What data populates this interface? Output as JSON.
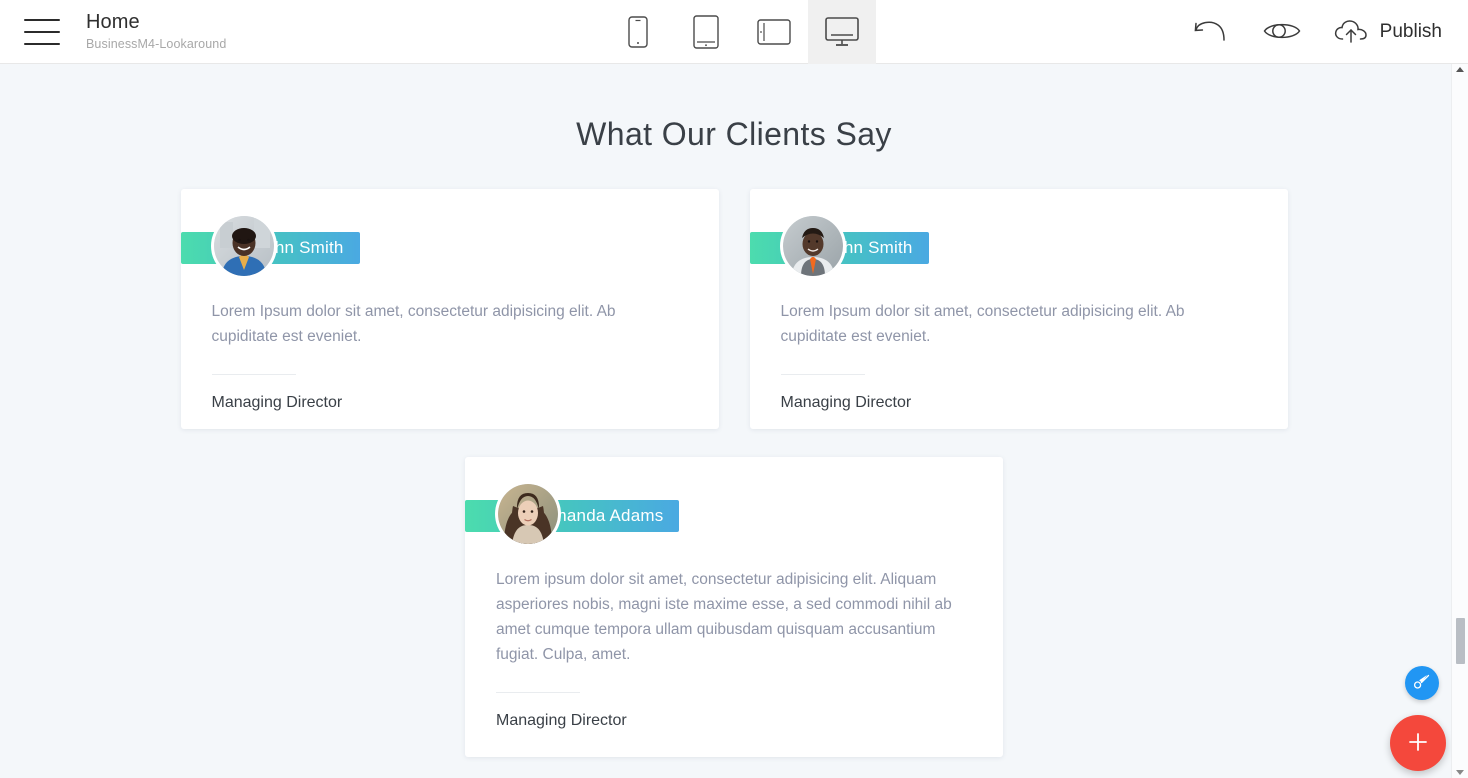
{
  "toolbar": {
    "menu_icon": "hamburger-icon",
    "page_title": "Home",
    "page_subtitle": "BusinessM4-Lookaround",
    "devices": [
      {
        "id": "mobile",
        "icon": "mobile-icon",
        "active": false
      },
      {
        "id": "tablet",
        "icon": "tablet-portrait-icon",
        "active": false
      },
      {
        "id": "landscape",
        "icon": "tablet-landscape-icon",
        "active": false
      },
      {
        "id": "desktop",
        "icon": "desktop-icon",
        "active": true
      }
    ],
    "undo_icon": "undo-icon",
    "preview_icon": "eye-preview-icon",
    "publish_icon": "cloud-upload-icon",
    "publish_label": "Publish"
  },
  "canvas": {
    "section_title": "What Our Clients Say",
    "background_color": "#f4f7fa",
    "testimonials": [
      {
        "name": "John Smith",
        "avatar": "avatar-man-blue-jacket",
        "quote": "Lorem Ipsum dolor sit amet, consectetur adipisicing elit. Ab cupiditate est eveniet.",
        "role": "Managing Director"
      },
      {
        "name": "John Smith",
        "avatar": "avatar-man-vest-orange-tie",
        "quote": "Lorem Ipsum dolor sit amet, consectetur adipisicing elit. Ab cupiditate est eveniet.",
        "role": "Managing Director"
      },
      {
        "name": "Amanda Adams",
        "avatar": "avatar-woman-long-hair",
        "quote": "Lorem ipsum dolor sit amet, consectetur adipisicing elit. Aliquam asperiores nobis, magni iste maxime esse, a sed commodi nihil ab amet cumque tempora ullam quibusdam quisquam accusantium fugiat. Culpa, amet.",
        "role": "Managing Director"
      }
    ]
  },
  "floating": {
    "brush_icon": "paintbrush-icon",
    "brush_color": "#2196f3",
    "add_icon": "plus-icon",
    "add_color": "#f4483c"
  },
  "colors": {
    "banner_gradient_start": "#4cdcae",
    "banner_gradient_end": "#4aa9e2",
    "quote_text": "#8f95a8",
    "title_text": "#3a4047"
  }
}
